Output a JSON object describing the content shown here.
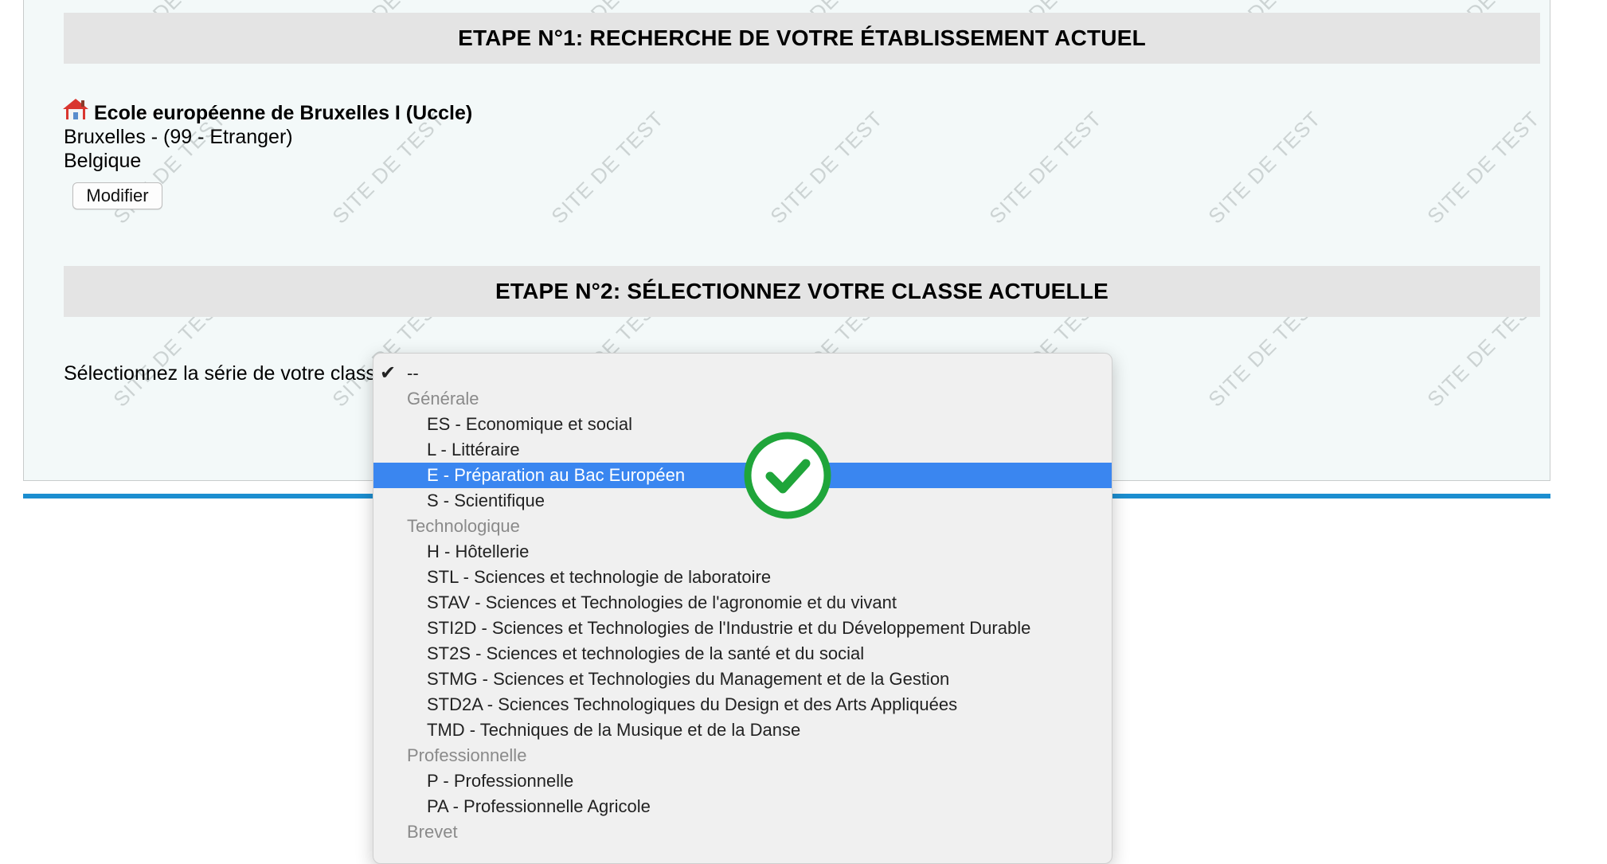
{
  "step1": {
    "title": "ETAPE N°1: RECHERCHE DE VOTRE ÉTABLISSEMENT ACTUEL",
    "school_name": "Ecole européenne de Bruxelles I (Uccle)",
    "school_city": "Bruxelles - (99 - Etranger)",
    "school_country": "Belgique",
    "modify_label": "Modifier"
  },
  "step2": {
    "title": "ETAPE N°2: SÉLECTIONNEZ VOTRE CLASSE ACTUELLE",
    "series_label": "Sélectionnez la série de votre classe:"
  },
  "watermark": "SITE DE TEST",
  "icons": {
    "school": "house-icon",
    "check": "checkmark-icon",
    "badge": "green-check-circle-icon"
  },
  "colors": {
    "selection": "#3a86f0",
    "accent_rule": "#1c8ed0",
    "badge_green": "#1fa53a"
  },
  "dropdown": {
    "checked_option": "--",
    "selected_option": "E - Préparation au Bac Européen",
    "options": [
      {
        "label": "--",
        "kind": "first"
      },
      {
        "label": "Générale",
        "kind": "group"
      },
      {
        "label": "ES - Economique et social",
        "kind": "item"
      },
      {
        "label": "L - Littéraire",
        "kind": "item"
      },
      {
        "label": "E - Préparation au Bac Européen",
        "kind": "item",
        "selected": true
      },
      {
        "label": "S - Scientifique",
        "kind": "item"
      },
      {
        "label": "Technologique",
        "kind": "group"
      },
      {
        "label": "H - Hôtellerie",
        "kind": "item"
      },
      {
        "label": "STL - Sciences et technologie de laboratoire",
        "kind": "item"
      },
      {
        "label": "STAV - Sciences et Technologies de l'agronomie et du vivant",
        "kind": "item"
      },
      {
        "label": "STI2D - Sciences et Technologies de l'Industrie et du Développement Durable",
        "kind": "item"
      },
      {
        "label": "ST2S - Sciences et technologies de la santé et du social",
        "kind": "item"
      },
      {
        "label": "STMG - Sciences et Technologies du Management et de la Gestion",
        "kind": "item"
      },
      {
        "label": "STD2A - Sciences Technologiques du Design et des Arts Appliquées",
        "kind": "item"
      },
      {
        "label": "TMD - Techniques de la Musique et de la Danse",
        "kind": "item"
      },
      {
        "label": "Professionnelle",
        "kind": "group"
      },
      {
        "label": "P - Professionnelle",
        "kind": "item"
      },
      {
        "label": "PA - Professionnelle Agricole",
        "kind": "item"
      },
      {
        "label": "Brevet",
        "kind": "group"
      }
    ]
  }
}
